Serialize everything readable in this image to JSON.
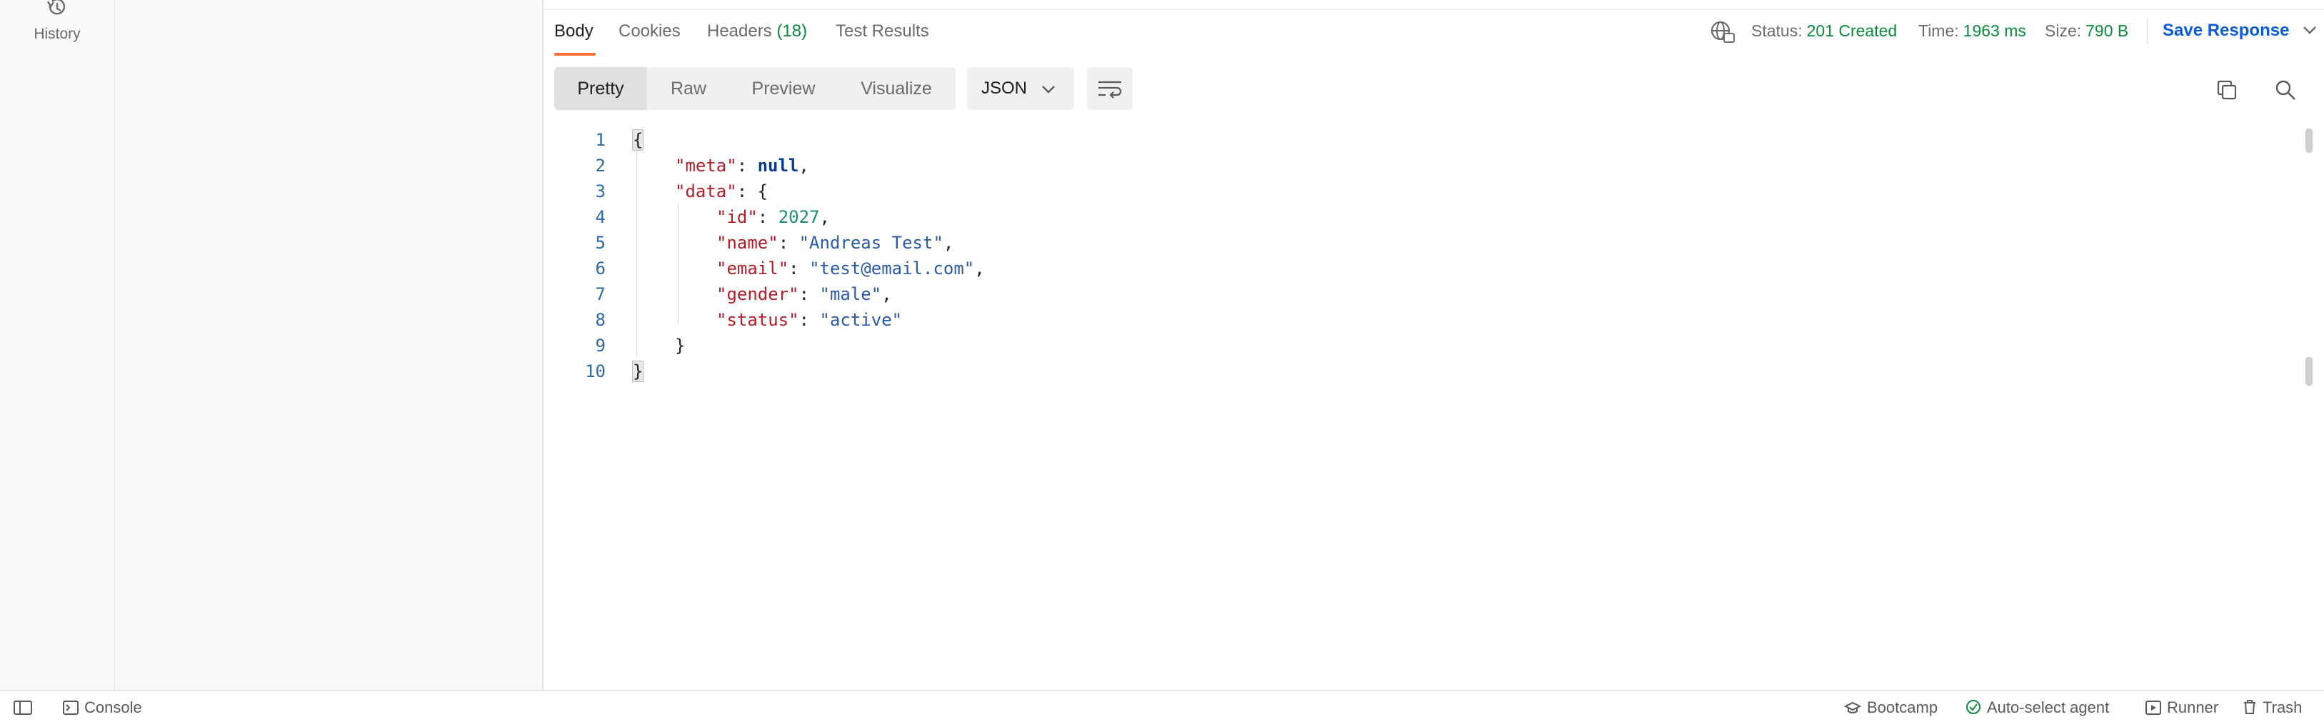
{
  "sidebar": {
    "history_label": "History"
  },
  "response": {
    "tabs": [
      {
        "label": "Body",
        "active": true
      },
      {
        "label": "Cookies"
      },
      {
        "label": "Headers",
        "count": "(18)"
      },
      {
        "label": "Test Results"
      }
    ],
    "status": {
      "status_label": "Status:",
      "status_value": "201 Created",
      "time_label": "Time:",
      "time_value": "1963 ms",
      "size_label": "Size:",
      "size_value": "790 B"
    },
    "save_label": "Save Response",
    "view_modes": [
      "Pretty",
      "Raw",
      "Preview",
      "Visualize"
    ],
    "format": "JSON",
    "accent": "#ff6c37"
  },
  "code": {
    "line_numbers": [
      "1",
      "2",
      "3",
      "4",
      "5",
      "6",
      "7",
      "8",
      "9",
      "10"
    ],
    "open_brace": "{",
    "close_brace": "}",
    "meta_key": "\"meta\"",
    "meta_value": "null",
    "data_key": "\"data\"",
    "id_key": "\"id\"",
    "id_value": "2027",
    "name_key": "\"name\"",
    "name_value": "\"Andreas Test\"",
    "email_key": "\"email\"",
    "email_value": "\"test@email.com\"",
    "gender_key": "\"gender\"",
    "gender_value": "\"male\"",
    "status_key": "\"status\"",
    "status_value": "\"active\""
  },
  "footer": {
    "console": "Console",
    "bootcamp": "Bootcamp",
    "auto_select": "Auto-select agent",
    "runner": "Runner",
    "trash": "Trash"
  }
}
